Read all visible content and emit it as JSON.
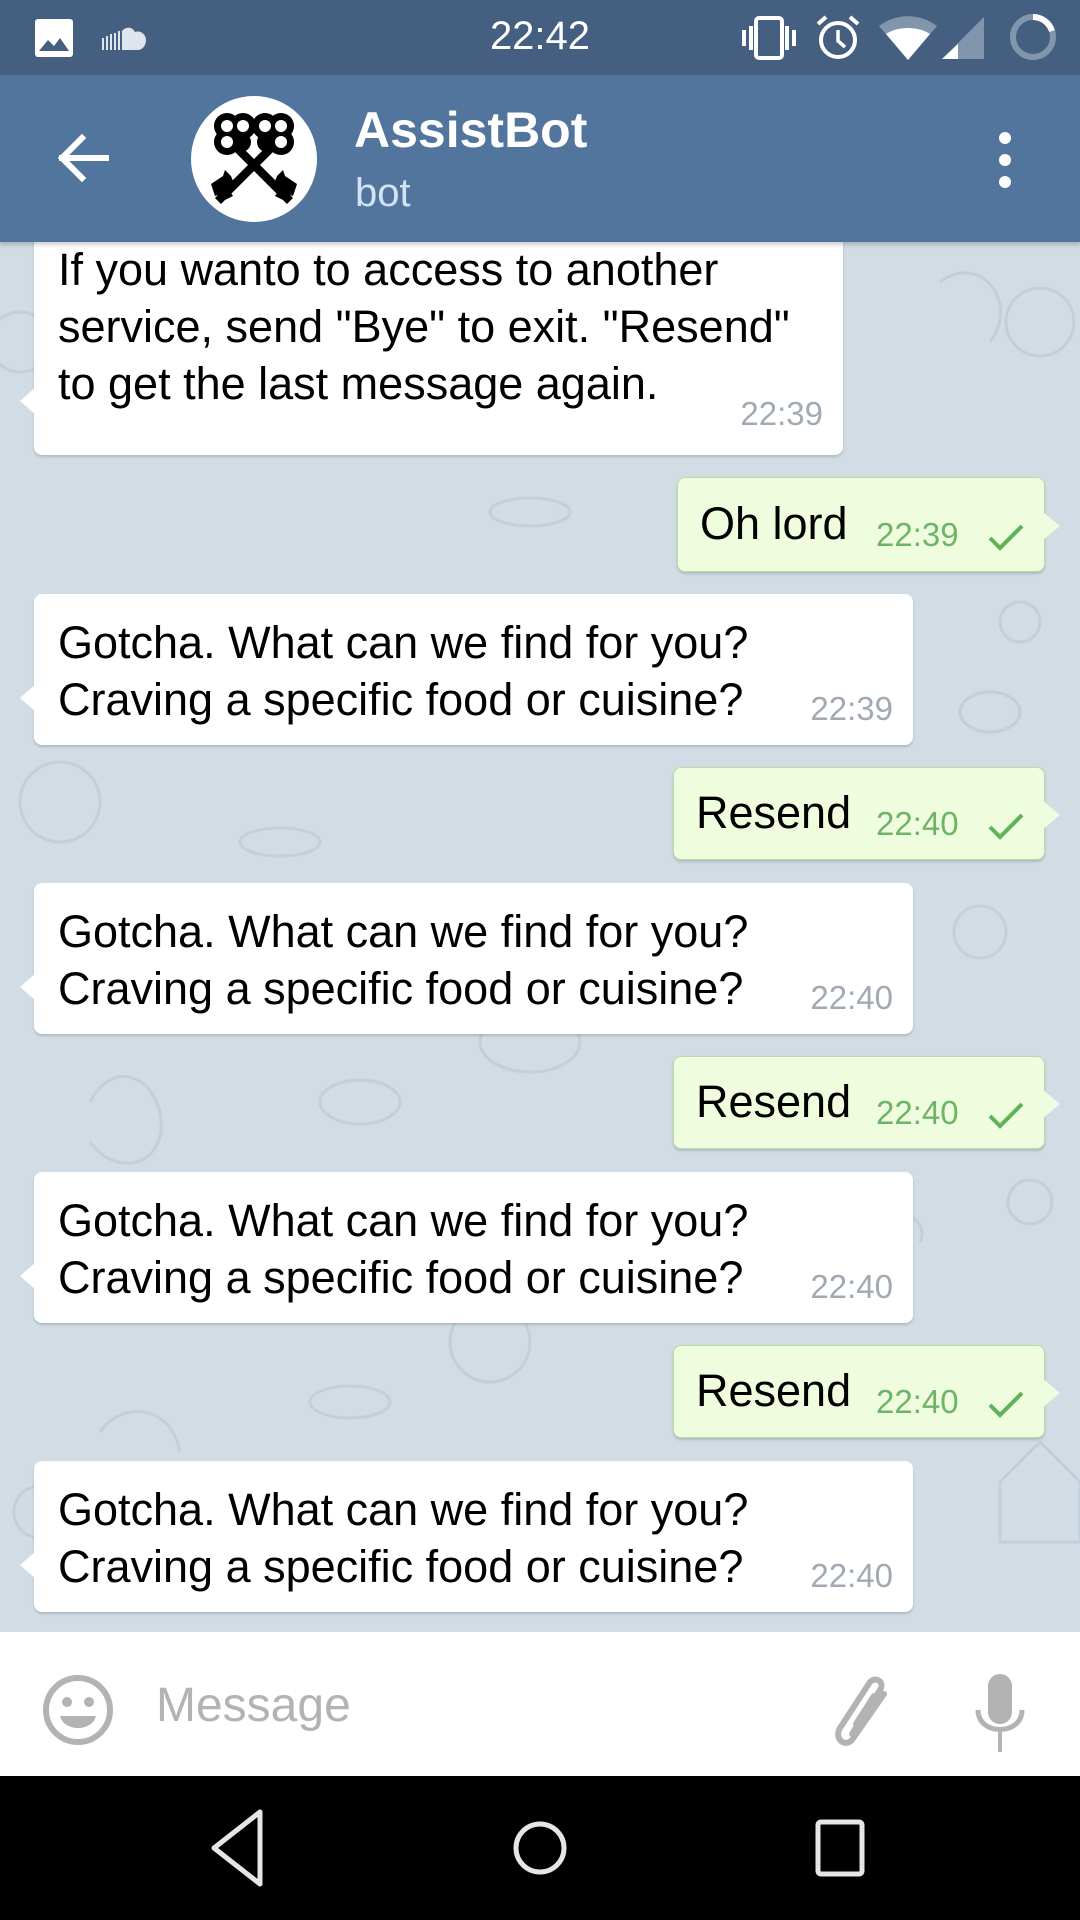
{
  "status_bar": {
    "time": "22:42",
    "left_icons": [
      "image-notification-icon",
      "soundcloud-icon"
    ],
    "right_icons": [
      "vibrate-icon",
      "alarm-icon",
      "wifi-icon",
      "signal-icon",
      "battery-icon"
    ]
  },
  "header": {
    "title": "AssistBot",
    "subtitle": "bot",
    "back_icon": "arrow-left-icon",
    "avatar_icon": "crossed-keys-icon",
    "menu_icon": "more-vertical-icon"
  },
  "messages": [
    {
      "direction": "in",
      "text": "Food delivery\nIf you wanto to access to another\nservice, send \"Bye\" to exit. \"Resend\"\nto get the last message again.",
      "time": "22:39"
    },
    {
      "direction": "out",
      "text": "Oh lord",
      "time": "22:39",
      "status": "sent"
    },
    {
      "direction": "in",
      "text": "Gotcha. What can we find for you?\nCraving a specific food or cuisine?",
      "time": "22:39"
    },
    {
      "direction": "out",
      "text": "Resend",
      "time": "22:40",
      "status": "sent"
    },
    {
      "direction": "in",
      "text": "Gotcha. What can we find for you?\nCraving a specific food or cuisine?",
      "time": "22:40"
    },
    {
      "direction": "out",
      "text": "Resend",
      "time": "22:40",
      "status": "sent"
    },
    {
      "direction": "in",
      "text": "Gotcha. What can we find for you?\nCraving a specific food or cuisine?",
      "time": "22:40"
    },
    {
      "direction": "out",
      "text": "Resend",
      "time": "22:40",
      "status": "sent"
    },
    {
      "direction": "in",
      "text": "Gotcha. What can we find for you?\nCraving a specific food or cuisine?",
      "time": "22:40"
    }
  ],
  "input_bar": {
    "placeholder": "Message",
    "value": "",
    "emoji_icon": "smiley-icon",
    "attach_icon": "paperclip-icon",
    "mic_icon": "microphone-icon"
  },
  "nav_bar": {
    "buttons": [
      "back-triangle-icon",
      "home-circle-icon",
      "recents-square-icon"
    ]
  },
  "colors": {
    "status_bar": "#455f80",
    "header": "#52759e",
    "chat_background": "#d1dce4",
    "incoming_bubble": "#ffffff",
    "outgoing_bubble": "#effdde",
    "outgoing_time": "#6db566",
    "incoming_time": "#a1aab3"
  }
}
